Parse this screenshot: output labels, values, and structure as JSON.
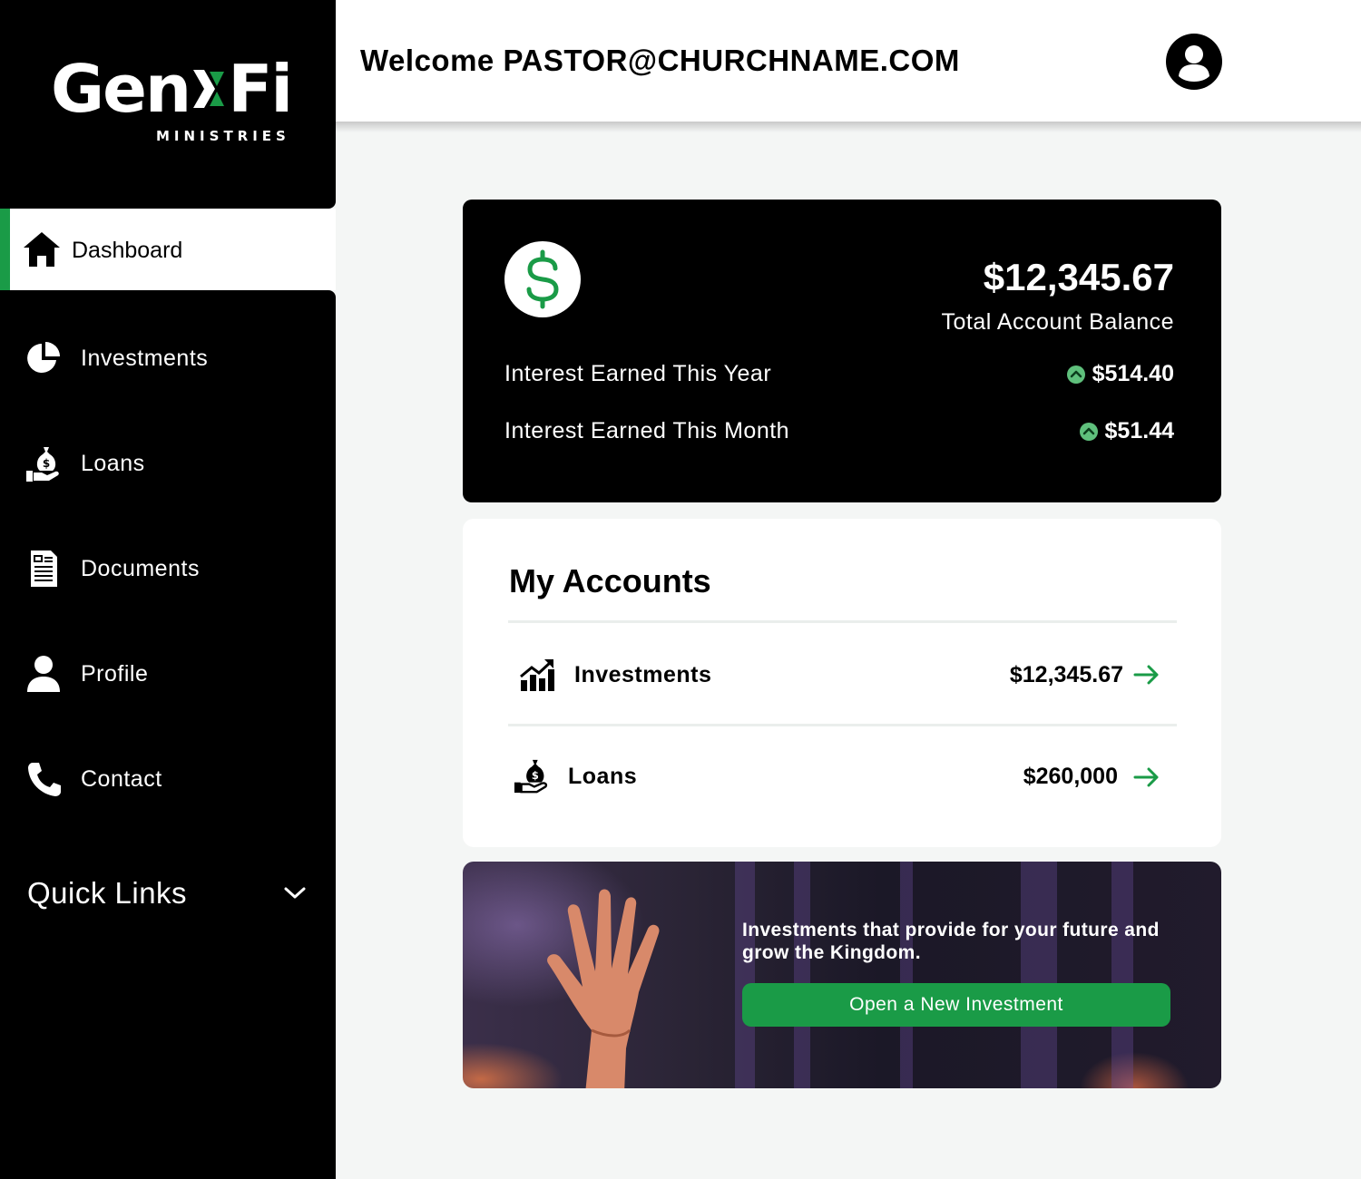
{
  "brand": {
    "name_part1": "Gen",
    "name_part2": "Fi",
    "subtitle": "MINISTRIES",
    "accent_color": "#1a9b47"
  },
  "header": {
    "welcome": "Welcome PASTOR@CHURCHNAME.COM",
    "avatar_icon": "user-circle-icon"
  },
  "sidebar": {
    "items": [
      {
        "label": "Dashboard",
        "icon": "home-icon",
        "active": true
      },
      {
        "label": "Investments",
        "icon": "pie-chart-icon"
      },
      {
        "label": "Loans",
        "icon": "money-bag-hand-icon"
      },
      {
        "label": "Documents",
        "icon": "document-icon"
      },
      {
        "label": "Profile",
        "icon": "user-icon"
      },
      {
        "label": "Contact",
        "icon": "phone-icon"
      }
    ],
    "quick_links": {
      "label": "Quick Links",
      "icon": "chevron-down-icon"
    }
  },
  "balance": {
    "total": "$12,345.67",
    "total_label": "Total Account Balance",
    "rows": [
      {
        "label": "Interest Earned This Year",
        "value": "$514.40"
      },
      {
        "label": "Interest Earned This Month",
        "value": "$51.44"
      }
    ]
  },
  "accounts": {
    "title": "My Accounts",
    "rows": [
      {
        "name": "Investments",
        "amount": "$12,345.67",
        "icon": "growth-chart-icon"
      },
      {
        "name": "Loans",
        "amount": "$260,000",
        "icon": "money-bag-hand-icon"
      }
    ]
  },
  "promo": {
    "text": "Investments that provide for your future and grow the Kingdom.",
    "button": "Open a New Investment"
  }
}
